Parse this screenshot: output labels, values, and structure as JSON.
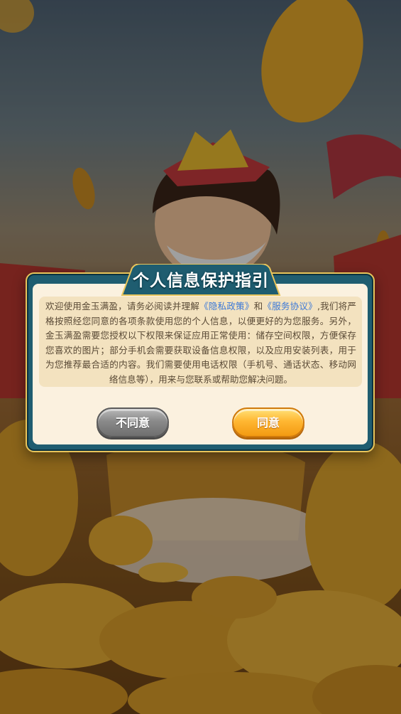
{
  "dialog": {
    "title": "个人信息保护指引",
    "message_before_privacy": "欢迎使用金玉满盈，请务必阅读并理解",
    "privacy_link": "《隐私政策》",
    "message_and": "和",
    "service_link": "《服务协议》",
    "message_after": ",我们将严格按照经您同意的各项条款使用您的个人信息，以便更好的为您服务。另外，金玉满盈需要您授权以下权限来保证应用正常使用：储存空间权限，方便保存您喜欢的图片；部分手机会需要获取设备信息权限，以及应用安装列表，用于为您推荐最合适的内容。我们需要使用电话权限（手机号、通话状态、移动网络信息等），用来与您联系或帮助您解决问题。",
    "disagree_label": "不同意",
    "agree_label": "同意"
  },
  "colors": {
    "frame": "#1f5d70",
    "frame_border": "#e8c45a",
    "panel": "#fbf1df",
    "content_box": "#f3e2bf",
    "link": "#3b78d8",
    "agree_button": "#ffb732",
    "disagree_button": "#8a8a8a"
  }
}
